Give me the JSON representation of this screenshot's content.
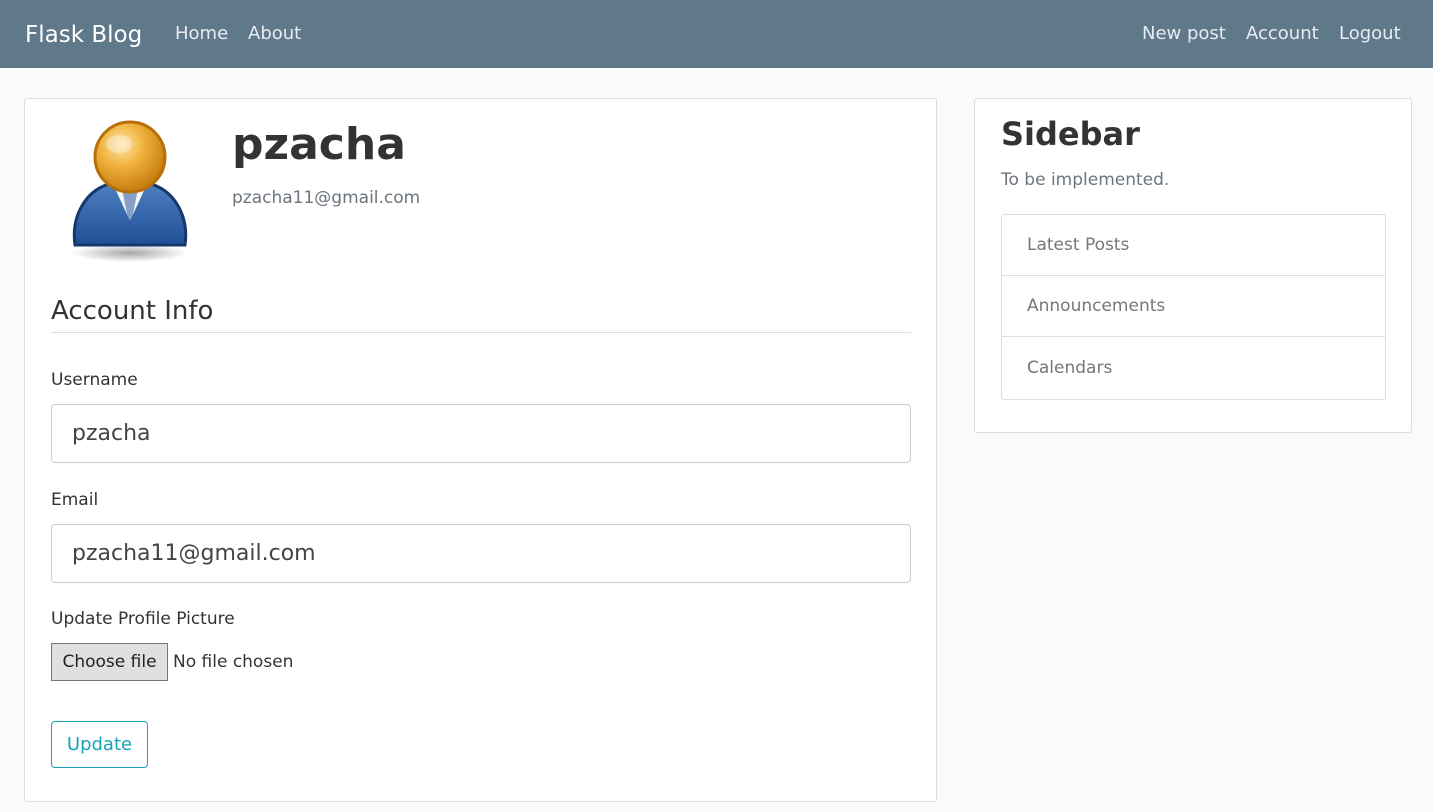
{
  "navbar": {
    "brand": "Flask Blog",
    "links_left": [
      "Home",
      "About"
    ],
    "links_right": [
      "New post",
      "Account",
      "Logout"
    ],
    "color": "#5f788a"
  },
  "profile": {
    "name": "pzacha",
    "email": "pzacha11@gmail.com",
    "avatar_icon": "user-avatar-icon"
  },
  "form": {
    "legend": "Account Info",
    "username_label": "Username",
    "username_value": "pzacha",
    "email_label": "Email",
    "email_value": "pzacha11@gmail.com",
    "picture_label": "Update Profile Picture",
    "choose_file_label": "Choose file",
    "file_status": "No file chosen",
    "submit_label": "Update",
    "accent_color": "#17a2b8"
  },
  "sidebar": {
    "title": "Sidebar",
    "text": "To be implemented.",
    "items": [
      "Latest Posts",
      "Announcements",
      "Calendars"
    ]
  }
}
